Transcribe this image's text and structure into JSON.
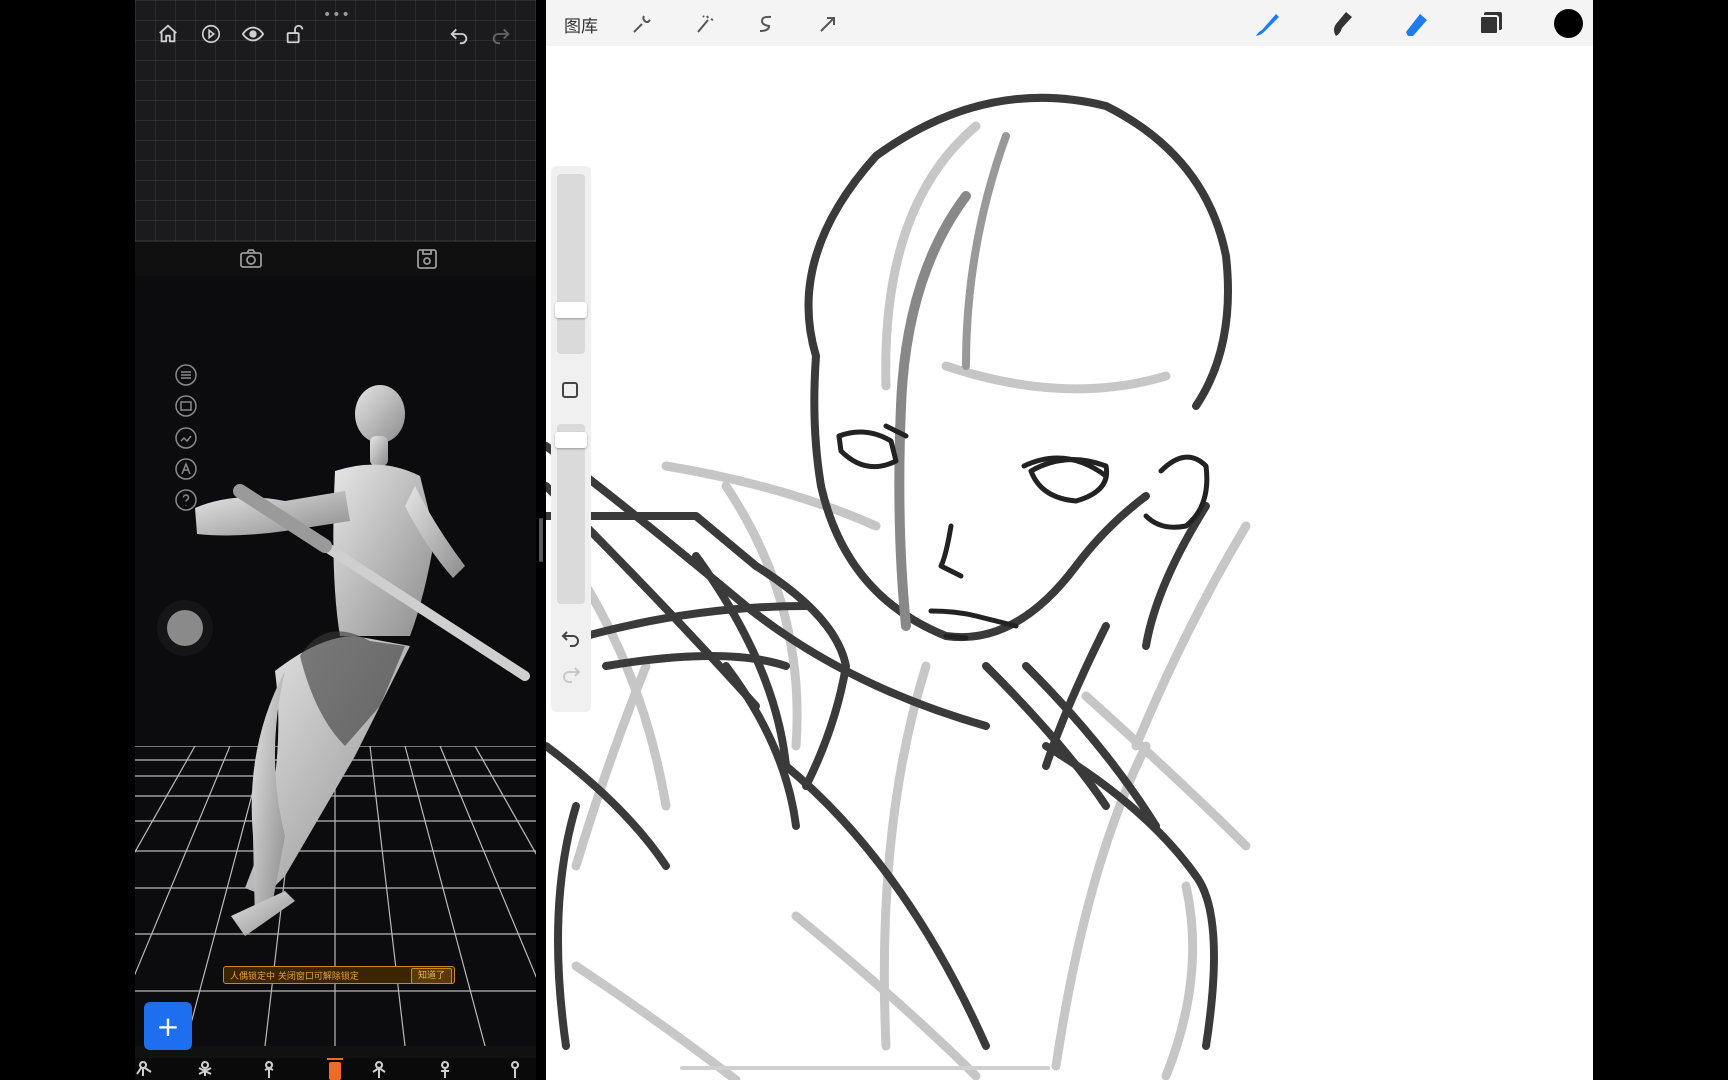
{
  "pose_app": {
    "toolbar": {
      "icons": [
        "home-icon",
        "play-circle-icon",
        "eye-icon",
        "unlock-icon",
        "undo-icon",
        "redo-icon"
      ],
      "grip": "•••"
    },
    "camera_bar": {
      "icons": [
        "camera-icon",
        "save-icon"
      ]
    },
    "viewport": {
      "side_icons": [
        "list-icon",
        "layers-icon",
        "image-icon",
        "text-icon",
        "help-icon"
      ],
      "lock_banner": {
        "text": "人偶锁定中 关闭窗口可解除锁定",
        "button_label": "知道了"
      }
    },
    "add_button": {
      "label": "+"
    },
    "pose_strip": {
      "thumbs": 8
    }
  },
  "procreate": {
    "toolbar": {
      "gallery_label": "图库",
      "adjust_icons": [
        "wrench-icon",
        "magic-wand-icon",
        "selection-icon",
        "transform-arrow-icon"
      ],
      "tools": [
        "brush-icon",
        "smudge-icon",
        "eraser-icon",
        "layers-icon"
      ],
      "active_color": "#000000",
      "accent_color": "#1e7bf0"
    },
    "sidebar": {
      "icons": [
        "modify-square-icon",
        "undo-icon",
        "redo-icon"
      ]
    }
  }
}
